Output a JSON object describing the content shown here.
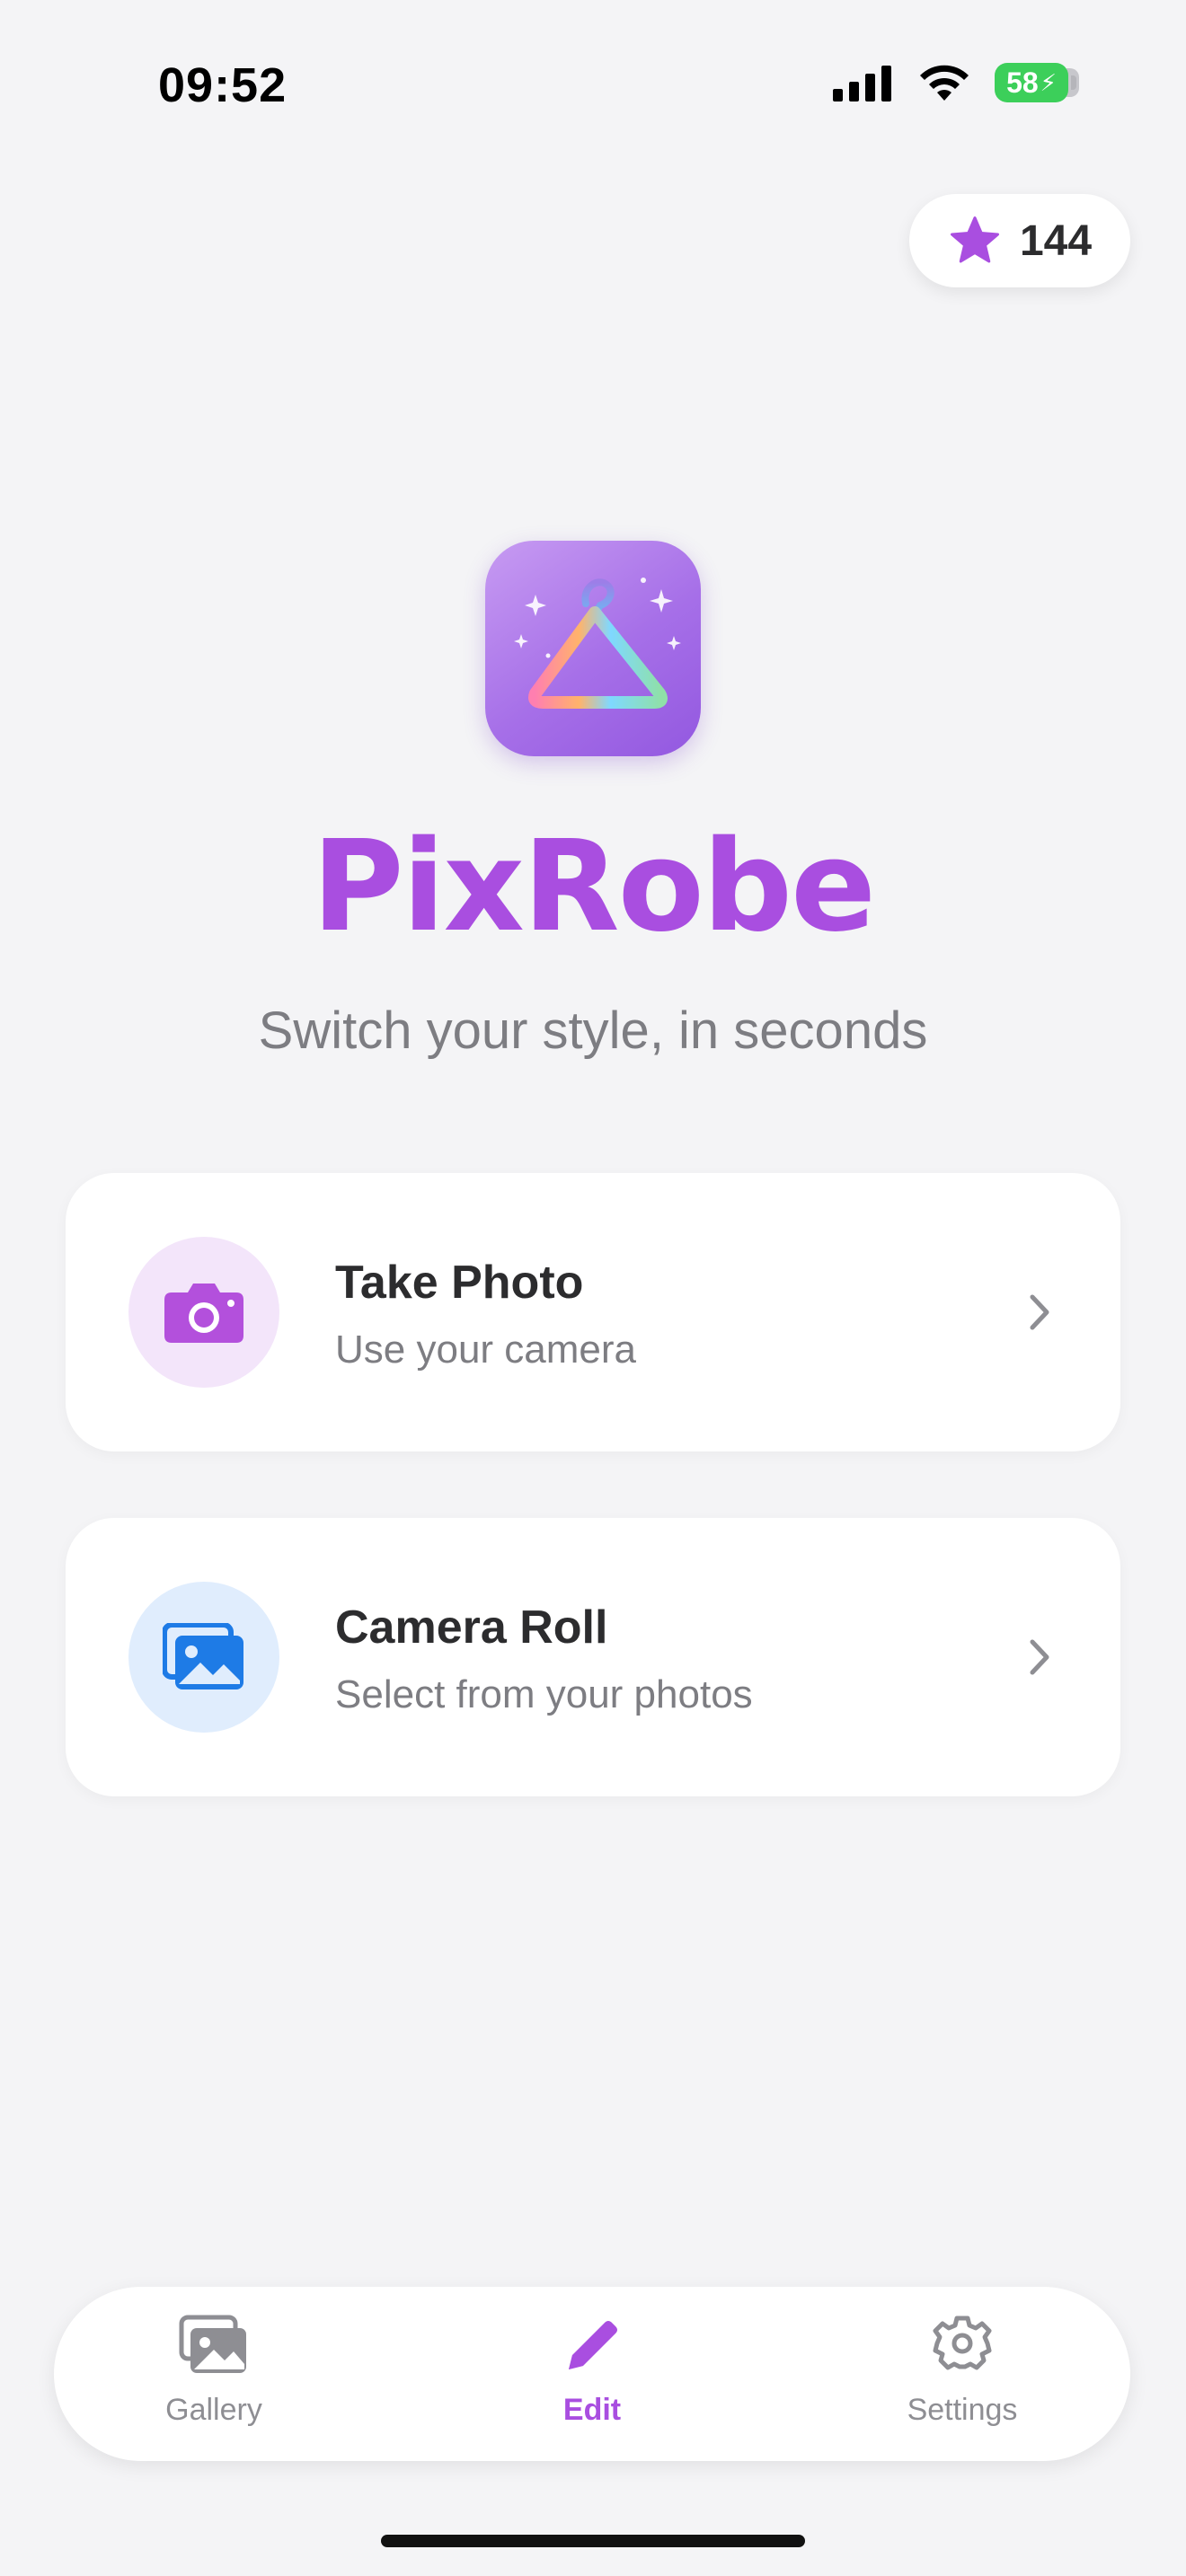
{
  "status_bar": {
    "time": "09:52",
    "battery": "58"
  },
  "credits": {
    "count": "144",
    "icon": "star-icon"
  },
  "app": {
    "name": "PixRobe",
    "tagline": "Switch your style, in seconds",
    "icon": "hanger-icon"
  },
  "options": [
    {
      "title": "Take Photo",
      "subtitle": "Use your camera",
      "icon": "camera-icon"
    },
    {
      "title": "Camera Roll",
      "subtitle": "Select from your photos",
      "icon": "photos-icon"
    }
  ],
  "tabs": [
    {
      "label": "Gallery",
      "icon": "gallery-icon"
    },
    {
      "label": "Edit",
      "icon": "pencil-icon",
      "selected": true
    },
    {
      "label": "Settings",
      "icon": "gear-icon"
    }
  ],
  "colors": {
    "brand": "#a94ee0",
    "camera_accent": "#b350dc",
    "photos_accent": "#1e7be6",
    "background": "#f4f4f6"
  }
}
